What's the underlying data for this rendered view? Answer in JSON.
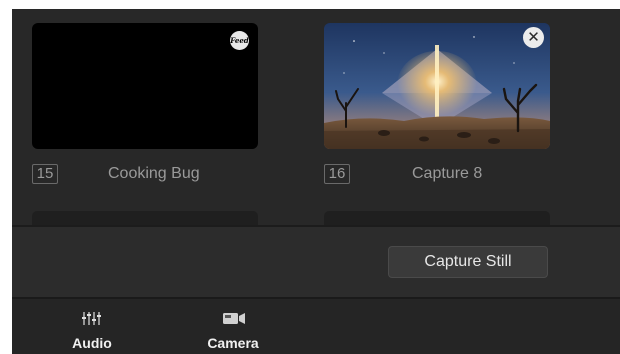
{
  "media_slots": [
    {
      "number": "15",
      "name": "Cooking Bug",
      "thumbnail": "black",
      "badge": "Feed",
      "badge_icon": "logo-badge-icon"
    },
    {
      "number": "16",
      "name": "Capture 8",
      "thumbnail": "desert-night-sky-photo",
      "close_icon": "close-icon",
      "close_glyph": "✕"
    }
  ],
  "controls": {
    "capture_still_label": "Capture Still"
  },
  "tabs": [
    {
      "label": "Audio",
      "icon": "audio-mixer-icon"
    },
    {
      "label": "Camera",
      "icon": "camera-icon"
    }
  ],
  "colors": {
    "panel_bg": "#2a2a2a",
    "tab_bar_bg": "#252525",
    "label_text": "#9a9a9a",
    "tab_text": "#f0f0f0"
  }
}
